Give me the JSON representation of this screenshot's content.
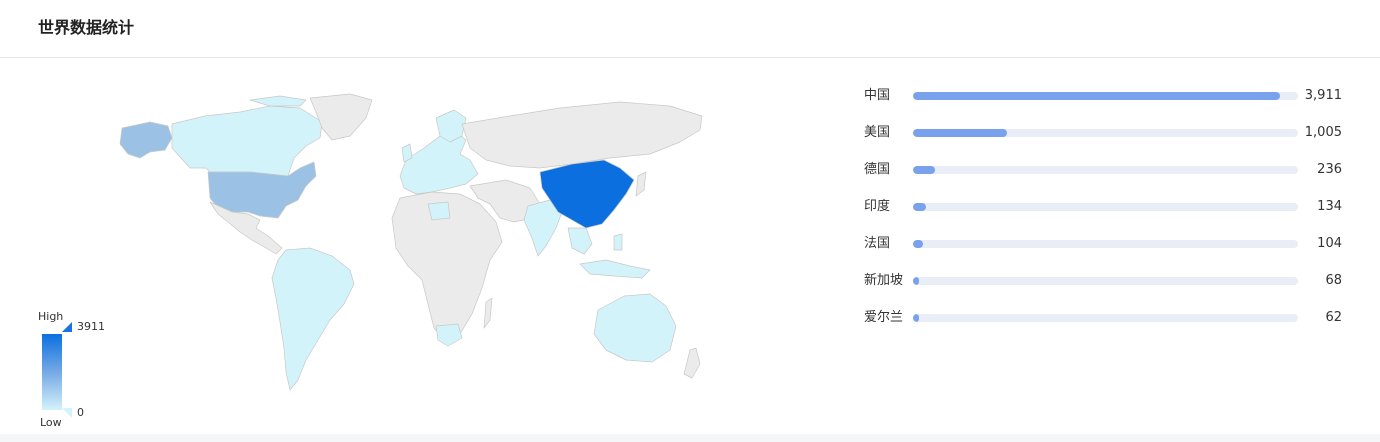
{
  "panel": {
    "title": "世界数据统计"
  },
  "visual_map": {
    "high_label": "High",
    "low_label": "Low",
    "max": 3911,
    "min": 0,
    "max_text": "3911",
    "min_text": "0",
    "colors": [
      "#d3f3fb",
      "#7fb0e6",
      "#0b6fe0"
    ]
  },
  "map": {
    "default_fill": "#ebebeb",
    "border_color": "#c8c8c8",
    "highlighted_countries": [
      {
        "name": "中国",
        "value": 3911,
        "color": "#0b6fe0"
      },
      {
        "name": "美国",
        "value": 1005,
        "color": "#9bc2e4"
      },
      {
        "name": "德国",
        "value": 236,
        "color": "#c9eefa"
      },
      {
        "name": "印度",
        "value": 134,
        "color": "#d3f3fb"
      },
      {
        "name": "法国",
        "value": 104,
        "color": "#d3f3fb"
      },
      {
        "name": "新加坡",
        "value": 68,
        "color": "#d3f3fb"
      },
      {
        "name": "爱尔兰",
        "value": 62,
        "color": "#d3f3fb"
      }
    ]
  },
  "chart_data": {
    "type": "bar",
    "categories": [
      "中国",
      "美国",
      "德国",
      "印度",
      "法国",
      "新加坡",
      "爱尔兰"
    ],
    "values": [
      3911,
      1005,
      236,
      134,
      104,
      68,
      62
    ],
    "value_labels": [
      "3,911",
      "1,005",
      "236",
      "134",
      "104",
      "68",
      "62"
    ],
    "max": 4100,
    "bar_color": "#7aa1ec",
    "track_color": "#e9edf5"
  }
}
